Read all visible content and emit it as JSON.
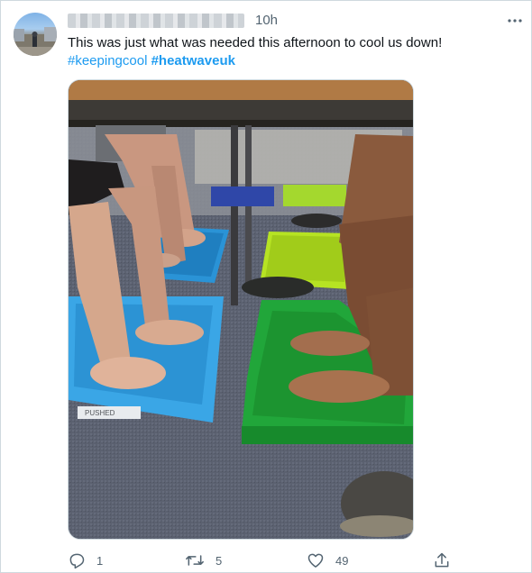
{
  "tweet": {
    "time": "10h",
    "text": "This was just what was needed this afternoon to cool us down!",
    "hashtags": [
      {
        "text": "#keepingcool",
        "bold": false
      },
      {
        "text": "#heatwaveuk",
        "bold": true
      }
    ]
  },
  "media": {
    "tray_label": "PUSHED"
  },
  "actions": {
    "reply_count": "1",
    "retweet_count": "5",
    "like_count": "49"
  },
  "icons": {
    "reply": "reply-icon",
    "retweet": "retweet-icon",
    "like": "heart-icon",
    "share": "share-icon",
    "more": "more-options-icon"
  },
  "colors": {
    "hashtag": "#1d9bf0",
    "secondary_text": "#536471",
    "border": "#cfd9de"
  }
}
